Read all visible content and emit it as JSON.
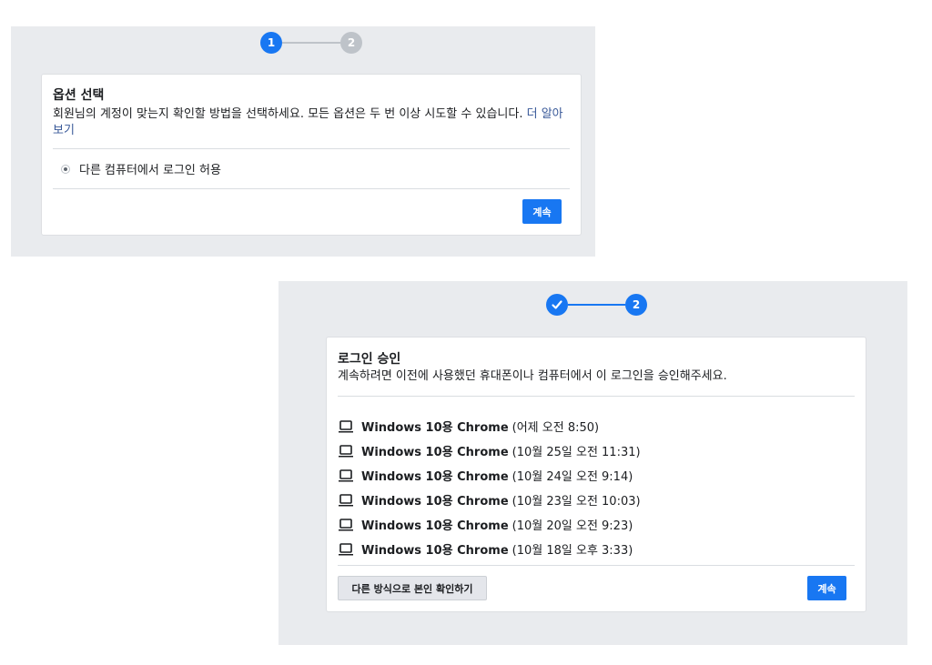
{
  "panel1": {
    "steps": [
      "1",
      "2"
    ],
    "card": {
      "title": "옵션 선택",
      "description": "회원님의 계정이 맞는지 확인할 방법을 선택하세요. 모든 옵션은 두 번 이상 시도할 수 있습니다.",
      "learn_more": "더 알아보기",
      "option_label": "다른 컴퓨터에서 로그인 허용",
      "continue_label": "계속"
    }
  },
  "panel2": {
    "steps": [
      "✓",
      "2"
    ],
    "card": {
      "title": "로그인 승인",
      "description": "계속하려면 이전에 사용했던 휴대폰이나 컴퓨터에서 이 로그인을 승인해주세요.",
      "devices": [
        {
          "name": "Windows 10용 Chrome",
          "time": "(어제 오전 8:50)"
        },
        {
          "name": "Windows 10용 Chrome",
          "time": "(10월 25일 오전 11:31)"
        },
        {
          "name": "Windows 10용 Chrome",
          "time": "(10월 24일 오전 9:14)"
        },
        {
          "name": "Windows 10용 Chrome",
          "time": "(10월 23일 오전 10:03)"
        },
        {
          "name": "Windows 10용 Chrome",
          "time": "(10월 20일 오전 9:23)"
        },
        {
          "name": "Windows 10용 Chrome",
          "time": "(10월 18일 오후 3:33)"
        }
      ],
      "alt_method_label": "다른 방식으로 본인 확인하기",
      "continue_label": "계속"
    }
  },
  "colors": {
    "accent": "#1877f2",
    "panel_bg": "#e9ebee",
    "inactive_step": "#bec3c9",
    "link": "#385898"
  },
  "icons": {
    "device_icon": "laptop-icon",
    "completed_step_icon": "check-icon"
  }
}
